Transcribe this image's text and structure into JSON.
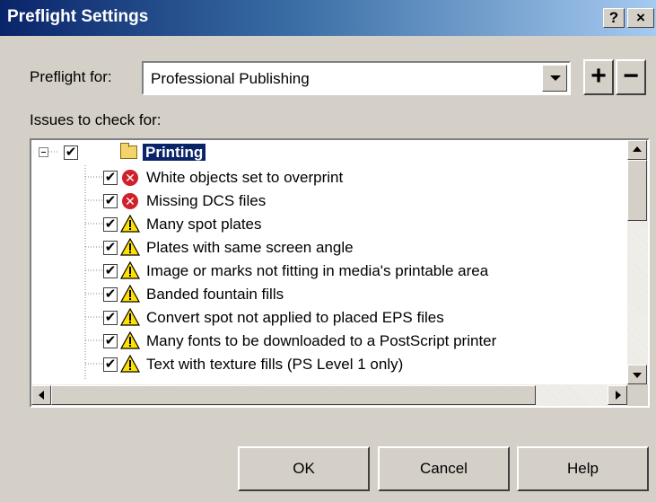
{
  "window": {
    "title": "Preflight Settings",
    "help_button": "?",
    "close_button": "×"
  },
  "preflight_for": {
    "label": "Preflight for:",
    "value": "Professional Publishing",
    "add_button": "+",
    "remove_button": "−"
  },
  "issues": {
    "label": "Issues to check for:",
    "group": {
      "label": "Printing",
      "checked": true
    },
    "items": [
      {
        "label": "White objects set to overprint",
        "checked": true,
        "icon": "error-icon"
      },
      {
        "label": "Missing DCS files",
        "checked": true,
        "icon": "error-icon"
      },
      {
        "label": "Many spot plates",
        "checked": true,
        "icon": "warning-icon"
      },
      {
        "label": "Plates with same screen angle",
        "checked": true,
        "icon": "warning-icon"
      },
      {
        "label": "Image or marks not fitting in media's printable area",
        "checked": true,
        "icon": "warning-icon"
      },
      {
        "label": "Banded fountain fills",
        "checked": true,
        "icon": "warning-icon"
      },
      {
        "label": "Convert spot not applied to placed EPS files",
        "checked": true,
        "icon": "warning-icon"
      },
      {
        "label": "Many fonts to be downloaded to a PostScript printer",
        "checked": true,
        "icon": "warning-icon"
      },
      {
        "label": "Text with texture fills (PS Level 1 only)",
        "checked": true,
        "icon": "warning-icon"
      }
    ]
  },
  "buttons": {
    "ok": "OK",
    "cancel": "Cancel",
    "help": "Help"
  },
  "colors": {
    "face": "#d4d0c8",
    "title_start": "#0a246a",
    "title_end": "#a6caf0",
    "error": "#d0202a",
    "warning": "#ffe100"
  }
}
